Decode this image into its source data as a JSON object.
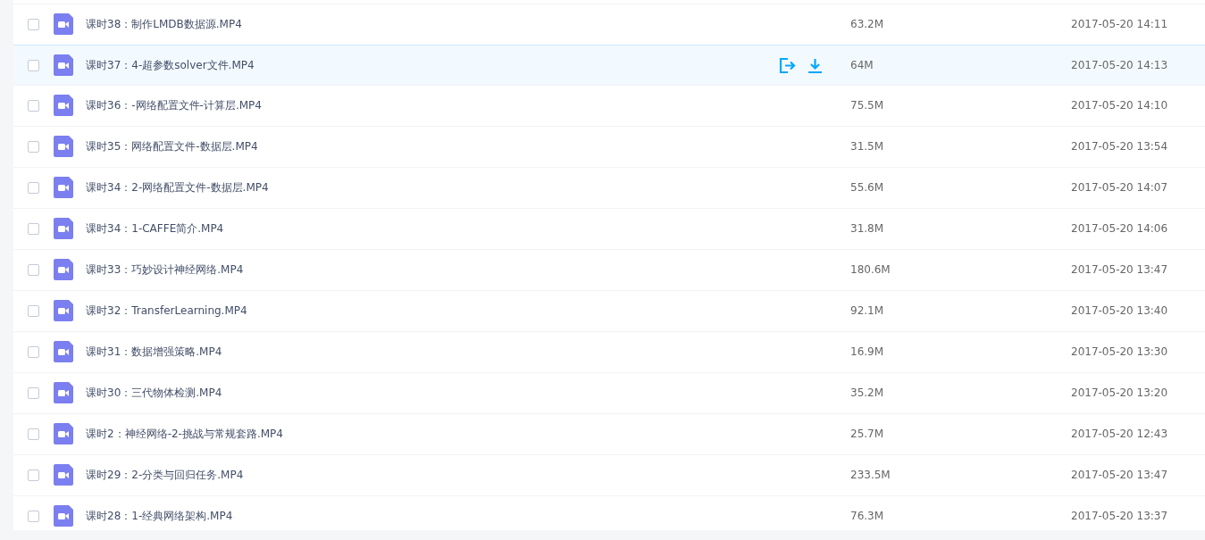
{
  "files": [
    {
      "name": "课时38：制作LMDB数据源.MP4",
      "size": "63.2M",
      "modified": "2017-05-20 14:11",
      "checked": false,
      "hovered": false
    },
    {
      "name": "课时37：4-超参数solver文件.MP4",
      "size": "64M",
      "modified": "2017-05-20 14:13",
      "checked": false,
      "hovered": true
    },
    {
      "name": "课时36：-网络配置文件-计算层.MP4",
      "size": "75.5M",
      "modified": "2017-05-20 14:10",
      "checked": false,
      "hovered": false
    },
    {
      "name": "课时35：网络配置文件-数据层.MP4",
      "size": "31.5M",
      "modified": "2017-05-20 13:54",
      "checked": false,
      "hovered": false
    },
    {
      "name": "课时34：2-网络配置文件-数据层.MP4",
      "size": "55.6M",
      "modified": "2017-05-20 14:07",
      "checked": false,
      "hovered": false
    },
    {
      "name": "课时34：1-CAFFE简介.MP4",
      "size": "31.8M",
      "modified": "2017-05-20 14:06",
      "checked": false,
      "hovered": false
    },
    {
      "name": "课时33：巧妙设计神经网络.MP4",
      "size": "180.6M",
      "modified": "2017-05-20 13:47",
      "checked": false,
      "hovered": false
    },
    {
      "name": "课时32：TransferLearning.MP4",
      "size": "92.1M",
      "modified": "2017-05-20 13:40",
      "checked": false,
      "hovered": false
    },
    {
      "name": "课时31：数据增强策略.MP4",
      "size": "16.9M",
      "modified": "2017-05-20 13:30",
      "checked": false,
      "hovered": false
    },
    {
      "name": "课时30：三代物体检测.MP4",
      "size": "35.2M",
      "modified": "2017-05-20 13:20",
      "checked": false,
      "hovered": false
    },
    {
      "name": "课时2：神经网络-2-挑战与常规套路.MP4",
      "size": "25.7M",
      "modified": "2017-05-20 12:43",
      "checked": false,
      "hovered": false
    },
    {
      "name": "课时29：2-分类与回归任务.MP4",
      "size": "233.5M",
      "modified": "2017-05-20 13:47",
      "checked": false,
      "hovered": false
    },
    {
      "name": "课时28：1-经典网络架构.MP4",
      "size": "76.3M",
      "modified": "2017-05-20 13:37",
      "checked": false,
      "hovered": false
    }
  ]
}
